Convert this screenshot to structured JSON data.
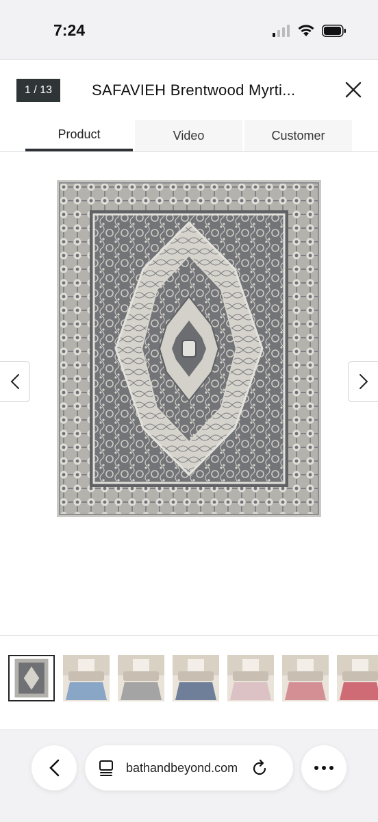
{
  "status": {
    "time": "7:24"
  },
  "modal": {
    "counter": "1 / 13",
    "title": "SAFAVIEH Brentwood Myrti...",
    "tabs": [
      {
        "label": "Product",
        "active": true
      },
      {
        "label": "Video",
        "active": false
      },
      {
        "label": "Customer",
        "active": false
      }
    ],
    "thumbnails": [
      {
        "name": "gray",
        "color": "#9a9a9a"
      },
      {
        "name": "blue",
        "color": "#8aa6c6"
      },
      {
        "name": "gray-room",
        "color": "#a4a4a4"
      },
      {
        "name": "navy",
        "color": "#6f7f99"
      },
      {
        "name": "blush",
        "color": "#dcc2c4"
      },
      {
        "name": "pink",
        "color": "#d48f95"
      },
      {
        "name": "red",
        "color": "#cf6b74"
      }
    ]
  },
  "browser": {
    "url": "bathandbeyond.com"
  },
  "colors": {
    "rug_dark": "#6b6d70",
    "rug_light": "#d2d0ca",
    "counter_bg": "#2f3437"
  }
}
